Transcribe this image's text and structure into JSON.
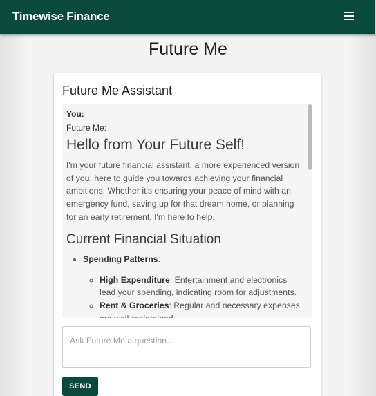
{
  "header": {
    "brand": "Timewise Finance",
    "menu_icon": "hamburger-menu-icon",
    "background_color": "#0a4a3c"
  },
  "page": {
    "title": "Future Me"
  },
  "assistant": {
    "title": "Future Me Assistant",
    "messages": {
      "user_label": "You:",
      "assistant_label": "Future Me:",
      "greeting_heading": "Hello from Your Future Self!",
      "intro_paragraph": "I'm your future financial assistant, a more experienced version of you, here to guide you towards achieving your financial ambitions. Whether it's ensuring your peace of mind with an emergency fund, saving up for that dream home, or planning for an early retirement, I'm here to help.",
      "section_heading": "Current Financial Situation",
      "list": {
        "spending_patterns_label": "Spending Patterns",
        "spending_patterns_suffix": ":",
        "items": [
          {
            "key": "High Expenditure",
            "text": ": Entertainment and electronics lead your spending, indicating room for adjustments."
          },
          {
            "key": "Rent & Groceries",
            "text": ": Regular and necessary expenses are well-maintained."
          }
        ]
      }
    },
    "input": {
      "placeholder": "Ask Future Me a question...",
      "value": ""
    },
    "send_label": "SEND",
    "accent_color": "#0a4a3c"
  }
}
